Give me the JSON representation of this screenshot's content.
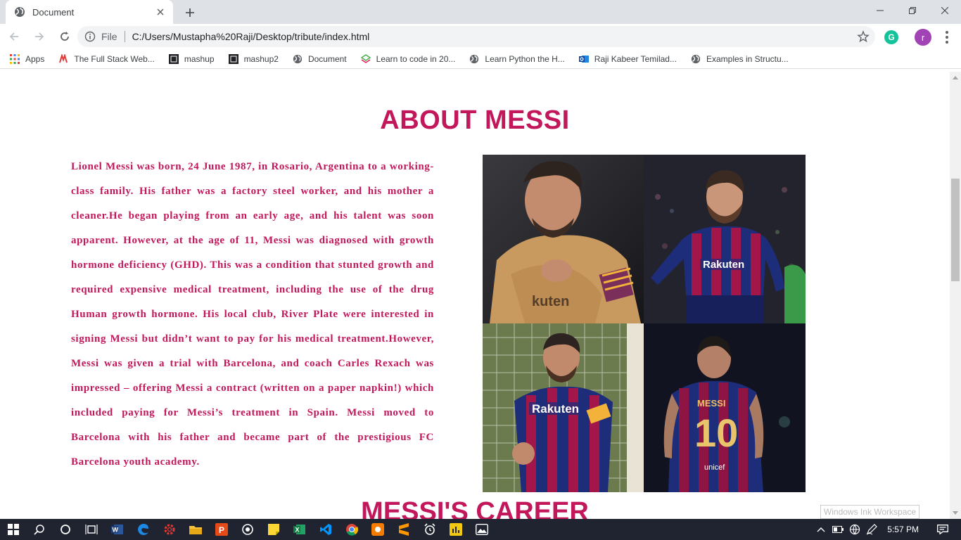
{
  "browser": {
    "tab_title": "Document",
    "url_scheme": "File",
    "url": "C:/Users/Mustapha%20Raji/Desktop/tribute/index.html",
    "profile_initial": "r"
  },
  "bookmarks": [
    {
      "label": "Apps",
      "icon": "apps-grid-icon"
    },
    {
      "label": "The Full Stack Web...",
      "icon": "fullstack-icon"
    },
    {
      "label": "mashup",
      "icon": "mashup-icon"
    },
    {
      "label": "mashup2",
      "icon": "mashup-icon"
    },
    {
      "label": "Document",
      "icon": "globe-icon"
    },
    {
      "label": "Learn to code in 20...",
      "icon": "codecademy-icon"
    },
    {
      "label": "Learn Python the H...",
      "icon": "globe-icon"
    },
    {
      "label": "Raji Kabeer Temilad...",
      "icon": "outlook-icon"
    },
    {
      "label": "Examples in Structu...",
      "icon": "globe-icon"
    }
  ],
  "page": {
    "about_heading": "ABOUT MESSI",
    "about_text": "Lionel Messi was born, 24 June 1987, in Rosario, Argentina to a working-class family. His father was a factory steel worker, and his mother a cleaner.He began playing from an early age, and his talent was soon apparent. However, at the age of 11, Messi was diagnosed with growth hormone deficiency (GHD). This was a condition that stunted growth and required expensive medical treatment, including the use of the drug Human growth hormone. His local club, River Plate were interested in signing Messi but didn’t want to pay for his medical treatment.However, Messi was given a trial with Barcelona, and coach Carles Rexach was impressed – offering Messi a contract (written on a paper napkin!) which included paying for Messi’s treatment in Spain. Messi moved to Barcelona with his father and became part of the prestigious FC Barcelona youth academy.",
    "career_heading": "MESSI'S CAREER",
    "photo_texts": {
      "sponsor": "Rakuten",
      "back_name": "MESSI",
      "back_number": "10",
      "back_sponsor": "unicef"
    }
  },
  "ink_tooltip": "Windows Ink Workspace",
  "taskbar": {
    "time": "5:57 PM"
  },
  "colors": {
    "accent": "#c2185b",
    "taskbar": "#1f2430"
  }
}
